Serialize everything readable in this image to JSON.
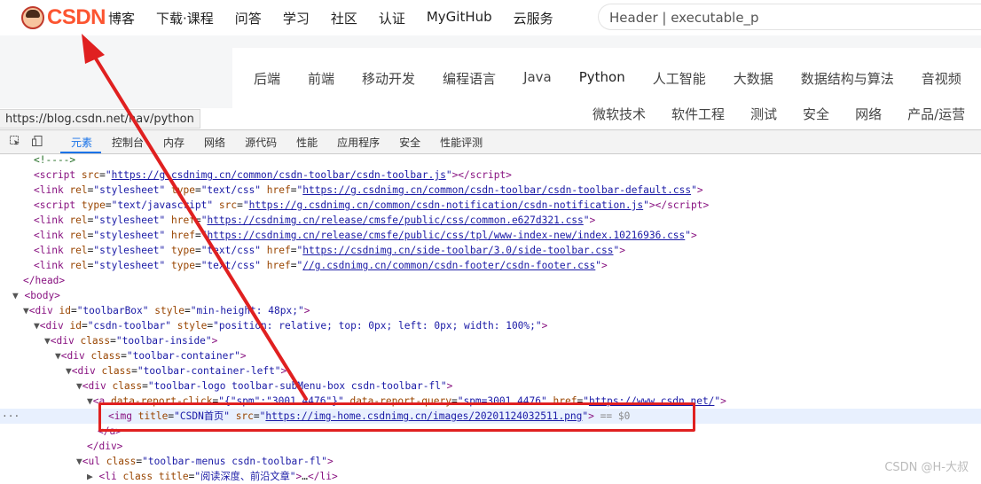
{
  "brand": {
    "logo_text": "CSDN"
  },
  "nav": {
    "items": [
      "博客",
      "下载·课程",
      "问答",
      "学习",
      "社区",
      "认证",
      "MyGitHub",
      "云服务"
    ]
  },
  "search": {
    "value": "Header | executable_p"
  },
  "categories": {
    "row1": [
      "后端",
      "前端",
      "移动开发",
      "编程语言",
      "Java",
      "Python",
      "人工智能",
      "大数据",
      "数据结构与算法",
      "音视频"
    ],
    "row2": [
      "微软技术",
      "软件工程",
      "测试",
      "安全",
      "网络",
      "产品/运营"
    ]
  },
  "status_url": "https://blog.csdn.net/nav/python",
  "devtools": {
    "tabs": [
      "元素",
      "控制台",
      "内存",
      "网络",
      "源代码",
      "性能",
      "应用程序",
      "安全",
      "性能评测"
    ],
    "active_tab": "元素"
  },
  "code": {
    "l0": "<!---->",
    "l1a": "https://g.csdnimg.cn/common/csdn-toolbar/csdn-toolbar.js",
    "l2a": "https://g.csdnimg.cn/common/csdn-toolbar/csdn-toolbar-default.css",
    "l3a": "https://g.csdnimg.cn/common/csdn-notification/csdn-notification.js",
    "l4a": "https://csdnimg.cn/release/cmsfe/public/css/common.e627d321.css",
    "l5a": "https://csdnimg.cn/release/cmsfe/public/css/tpl/www-index-new/index.10216936.css",
    "l6a": "https://csdnimg.cn/side-toolbar/3.0/side-toolbar.css",
    "l7a": "//g.csdnimg.cn/common/csdn-footer/csdn-footer.css",
    "img_title": "\"CSDN首页\"",
    "img_src": "https://img-home.csdnimg.cn/images/20201124032511.png",
    "eq_marker": "== $0",
    "li_title": "\"阅读深度、前沿文章\""
  },
  "watermark": "CSDN @H-大叔",
  "colors": {
    "brand": "#fc5531",
    "annotation_red": "#e02020",
    "devtools_active": "#1a73e8"
  }
}
